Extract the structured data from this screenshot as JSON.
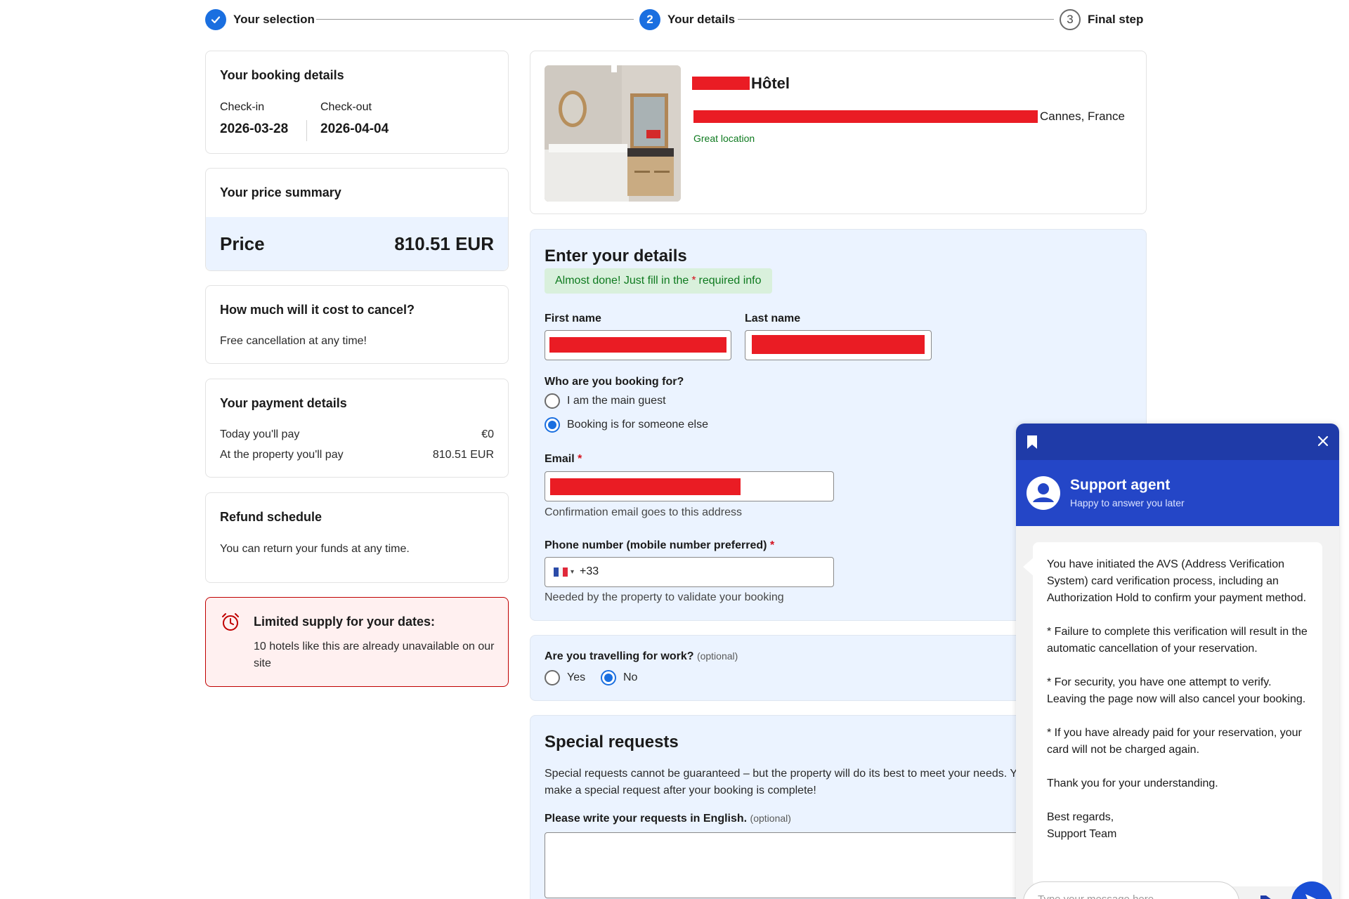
{
  "stepper": {
    "step1": {
      "label": "Your selection",
      "number": "✓"
    },
    "step2": {
      "label": "Your details",
      "number": "2"
    },
    "step3": {
      "label": "Final step",
      "number": "3"
    }
  },
  "booking": {
    "title": "Your booking details",
    "checkin_label": "Check-in",
    "checkin_value": "2026-03-28",
    "checkout_label": "Check-out",
    "checkout_value": "2026-04-04"
  },
  "price_summary": {
    "title": "Your price summary",
    "price_label": "Price",
    "price_value": "810.51 EUR"
  },
  "cancel": {
    "title": "How much will it cost to cancel?",
    "text": "Free cancellation at any time!"
  },
  "payment": {
    "title": "Your payment details",
    "today_label": "Today you'll pay",
    "today_value": "€0",
    "property_label": "At the property you'll pay",
    "property_value": "810.51 EUR"
  },
  "refund": {
    "title": "Refund schedule",
    "text": "You can return your funds at any time."
  },
  "limited": {
    "title": "Limited supply for your dates:",
    "text": "10 hotels like this are already unavailable on our site"
  },
  "hotel": {
    "name": "Hôtel",
    "location": "Cannes, France",
    "tag": "Great location"
  },
  "form": {
    "title": "Enter your details",
    "notice_pre": "Almost done! Just fill in the",
    "notice_star": "*",
    "notice_post": "required info",
    "first_name_label": "First name",
    "last_name_label": "Last name",
    "booking_for_label": "Who are you booking for?",
    "option_main": "I am the main guest",
    "option_else": "Booking is for someone else",
    "email_label": "Email",
    "required_mark": "*",
    "email_helper": "Confirmation email goes to this address",
    "phone_label": "Phone number (mobile number preferred)",
    "phone_prefix": "+33",
    "phone_helper": "Needed by the property to validate your booking"
  },
  "work": {
    "label": "Are you travelling for work?",
    "optional": "(optional)",
    "yes": "Yes",
    "no": "No"
  },
  "special": {
    "title": "Special requests",
    "text_line1": "Special requests cannot be guaranteed – but the property will do its best to meet your needs. You can always",
    "text_line2": "make a special request after your booking is complete!",
    "requests_label": "Please write your requests in English.",
    "optional": "(optional)"
  },
  "chat": {
    "agent_name": "Support agent",
    "agent_status": "Happy to answer you later",
    "messages": [
      "You have initiated the AVS (Address Verification System) card verification process, including an Authorization Hold to confirm your payment method.",
      "* Failure to complete this verification will result in the automatic cancellation of your reservation.",
      "* For security, you have one attempt to verify. Leaving the page now will also cancel your booking.",
      "* If you have already paid for your reservation, your card will not be charged again.",
      "Thank you for your understanding.",
      "Best regards,"
    ],
    "signature": "Support Team",
    "input_placeholder": "Type your message here..."
  },
  "colors": {
    "accent": "#1a6fe0",
    "chat_header": "#2446c7",
    "redaction": "#ea1c24",
    "success_text": "#0e7a1f"
  }
}
